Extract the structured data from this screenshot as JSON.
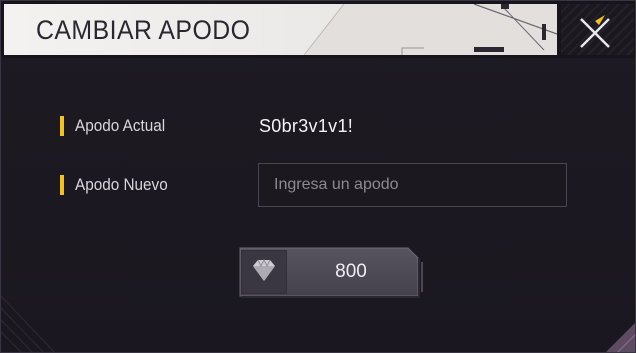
{
  "dialog": {
    "title": "CAMBIAR APODO",
    "close_icon": "close-x-icon"
  },
  "current_nickname": {
    "label": "Apodo Actual",
    "value": "S0br3v1v1!"
  },
  "new_nickname": {
    "label": "Apodo Nuevo",
    "placeholder": "Ingresa un apodo",
    "value": ""
  },
  "purchase": {
    "currency_icon": "diamond-icon",
    "price": "800"
  },
  "colors": {
    "accent_yellow": "#f2c31d",
    "panel_bg": "#1c1920",
    "title_plate": "#efedeb"
  }
}
